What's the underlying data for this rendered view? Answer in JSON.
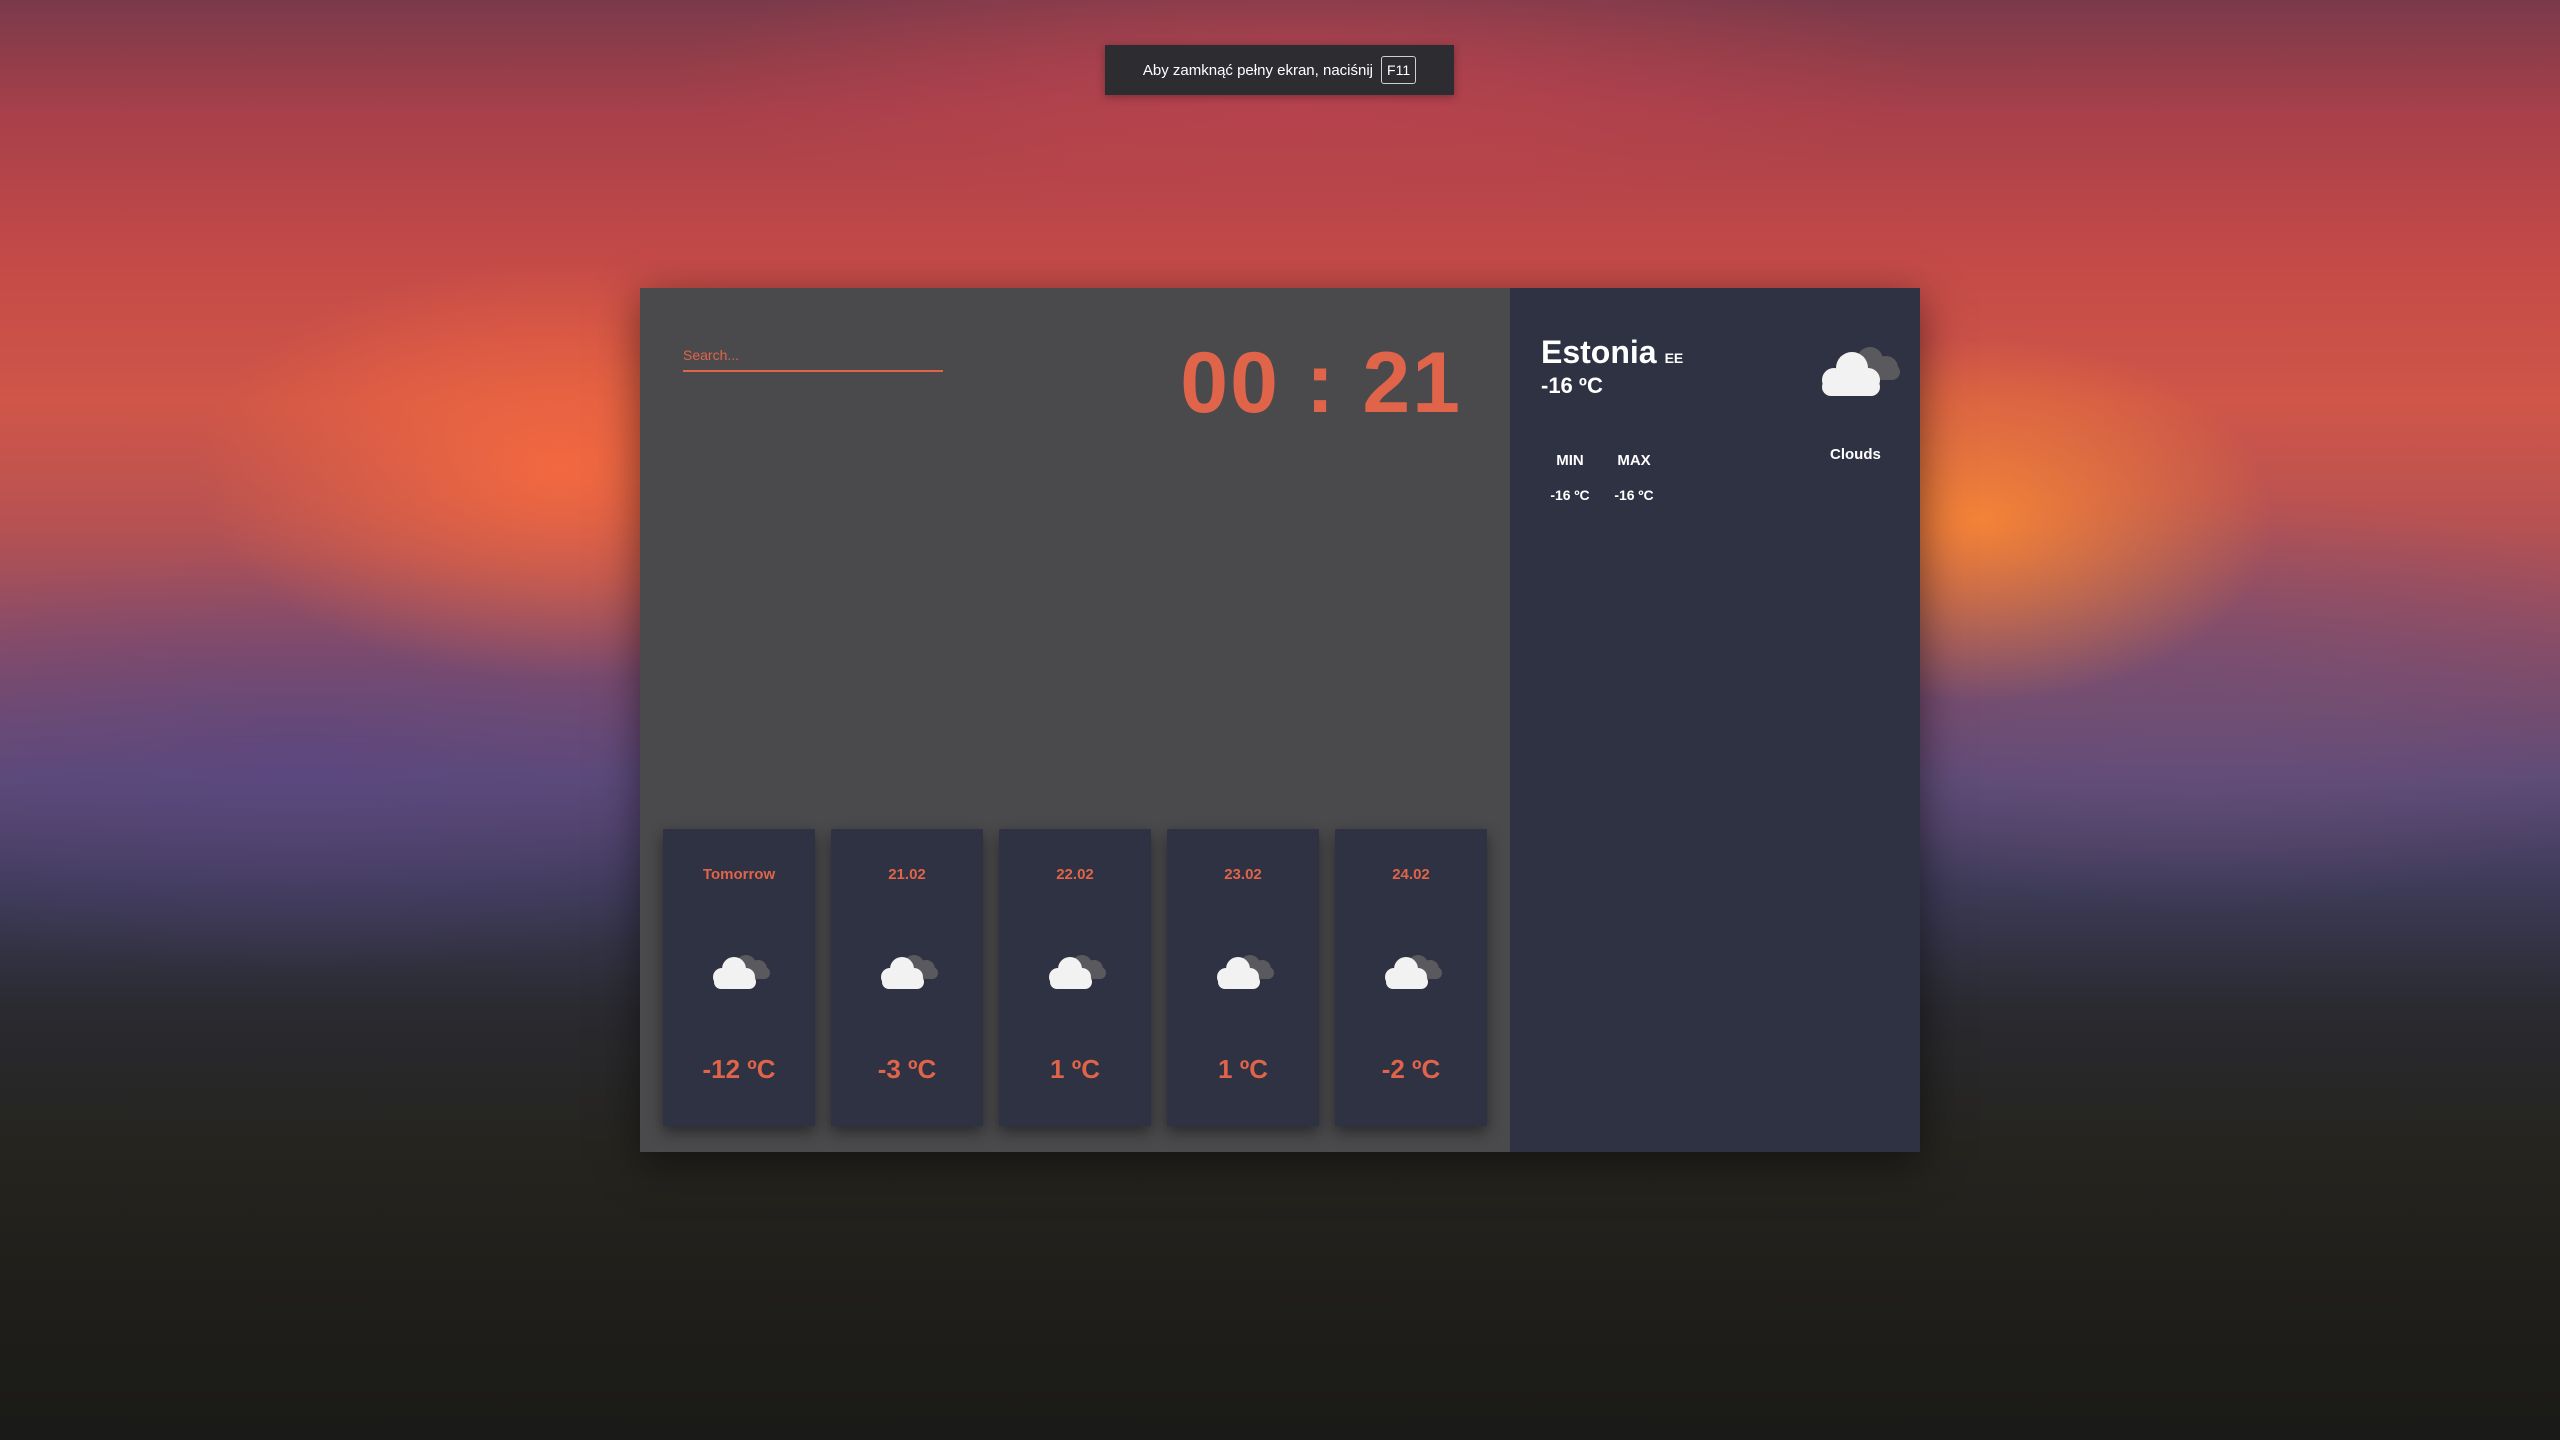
{
  "fullscreen_notice": {
    "text": "Aby zamknąć pełny ekran, naciśnij",
    "key": "F11"
  },
  "search": {
    "placeholder": "Search..."
  },
  "clock": {
    "time": "00 : 21"
  },
  "current": {
    "country": "Estonia",
    "country_code": "EE",
    "temp": "-16 ºC",
    "condition": "Clouds",
    "icon": "clouds-icon",
    "min_label": "MIN",
    "max_label": "MAX",
    "min": "-16 ºC",
    "max": "-16 ºC"
  },
  "forecast": [
    {
      "label": "Tomorrow",
      "temp": "-12 ºC",
      "icon": "clouds-icon"
    },
    {
      "label": "21.02",
      "temp": "-3 ºC",
      "icon": "clouds-icon"
    },
    {
      "label": "22.02",
      "temp": "1 ºC",
      "icon": "clouds-icon"
    },
    {
      "label": "23.02",
      "temp": "1 ºC",
      "icon": "clouds-icon"
    },
    {
      "label": "24.02",
      "temp": "-2 ºC",
      "icon": "clouds-icon"
    }
  ],
  "colors": {
    "accent": "#e0644a",
    "panel_left": "#4a4a4d",
    "panel_right": "#2f3242"
  }
}
